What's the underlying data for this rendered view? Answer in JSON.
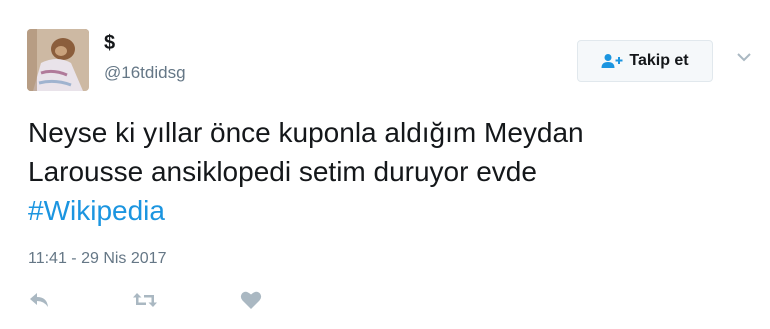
{
  "user": {
    "display_name": "$",
    "handle": "@16tdidsg"
  },
  "follow_button": {
    "label": "Takip et",
    "icon": "add-user-icon"
  },
  "menu": {
    "icon": "chevron-down-icon"
  },
  "tweet": {
    "text_line1": "Neyse ki yıllar önce kuponla aldığım Meydan",
    "text_line2": "Larousse ansiklopedi setim duruyor evde",
    "hashtag": "#Wikipedia",
    "timestamp": "11:41 - 29 Nis 2017"
  },
  "actions": {
    "reply_icon": "reply-icon",
    "retweet_icon": "retweet-icon",
    "like_icon": "heart-icon"
  },
  "colors": {
    "link": "#1b95e0",
    "muted": "#657786",
    "text": "#14171a",
    "icon": "#aab8c2"
  }
}
